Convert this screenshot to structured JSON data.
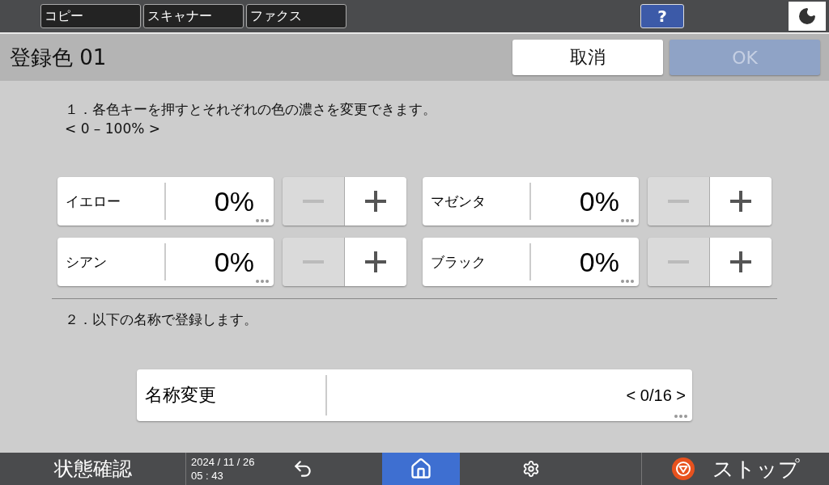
{
  "app_tabs": [
    {
      "label": "コピー"
    },
    {
      "label": "スキャナー"
    },
    {
      "label": "ファクス"
    }
  ],
  "help_button": {
    "label": "?"
  },
  "title": "登録色 01",
  "cancel_button": {
    "label": "取消",
    "disabled": false
  },
  "ok_button": {
    "label": "OK",
    "disabled": true
  },
  "step1": {
    "text": "１．各色キーを押すとそれぞれの色の濃さを変更できます。",
    "range": "< 0 – 100% >"
  },
  "colors": [
    {
      "name": "イエロー",
      "value": "0%",
      "minus_disabled": true,
      "plus_disabled": false
    },
    {
      "name": "マゼンタ",
      "value": "0%",
      "minus_disabled": true,
      "plus_disabled": false
    },
    {
      "name": "シアン",
      "value": "0%",
      "minus_disabled": true,
      "plus_disabled": false
    },
    {
      "name": "ブラック",
      "value": "0%",
      "minus_disabled": true,
      "plus_disabled": false
    }
  ],
  "step2": "２．以下の名称で登録します。",
  "name_field": {
    "label": "名称変更",
    "counter": "< 0/16 >"
  },
  "bottom_bar": {
    "status": "状態確認",
    "date": "2024 / 11 / 26",
    "time": "05 : 43",
    "nav_items": [
      {
        "kind": "back",
        "selected": false
      },
      {
        "kind": "home",
        "selected": true
      },
      {
        "kind": "settings",
        "selected": false
      }
    ],
    "stop": "ストップ"
  }
}
